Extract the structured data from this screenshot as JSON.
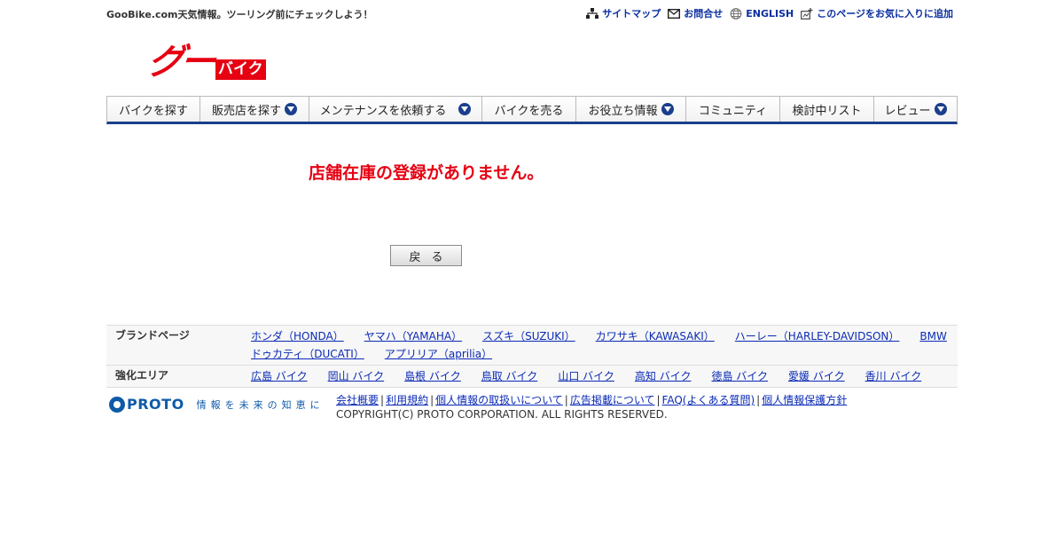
{
  "header": {
    "tagline": "GooBike.com天気情報。ツーリング前にチェックしよう！",
    "links": [
      {
        "label": "サイトマップ",
        "icon": "sitemap-icon"
      },
      {
        "label": "お問合せ",
        "icon": "mail-icon"
      },
      {
        "label": "ENGLISH",
        "icon": "globe-icon"
      },
      {
        "label": "このページをお気に入りに追加",
        "icon": "bookmark-add-icon"
      }
    ]
  },
  "logo": {
    "goo": "グー",
    "bike": "バイク",
    "color": "#e60012"
  },
  "nav": [
    {
      "label": "バイクを探す",
      "dropdown": false
    },
    {
      "label": "販売店を探す",
      "dropdown": true
    },
    {
      "label": "メンテナンスを依頼する",
      "dropdown": true
    },
    {
      "label": "バイクを売る",
      "dropdown": false
    },
    {
      "label": "お役立ち情報",
      "dropdown": true
    },
    {
      "label": "コミュニティ",
      "dropdown": false
    },
    {
      "label": "検討中リスト",
      "dropdown": false
    },
    {
      "label": "レビュー",
      "dropdown": true
    }
  ],
  "main": {
    "message": "店舗在庫の登録がありません。",
    "back_button": "戻る"
  },
  "footer_table": [
    {
      "heading": "ブランドページ",
      "links": [
        "ホンダ（HONDA）",
        "ヤマハ（YAMAHA）",
        "スズキ（SUZUKI）",
        "カワサキ（KAWASAKI）",
        "ハーレー（HARLEY-DAVIDSON）",
        "BMW",
        "ドゥカティ（DUCATI）",
        "アプリリア（aprilia）"
      ]
    },
    {
      "heading": "強化エリア",
      "links": [
        "広島 バイク",
        "岡山 バイク",
        "島根 バイク",
        "鳥取 バイク",
        "山口 バイク",
        "高知 バイク",
        "徳島 バイク",
        "愛媛 バイク",
        "香川 バイク"
      ]
    }
  ],
  "footer": {
    "company_logo": "PROTO",
    "slogan": "情報を未来の知恵に",
    "links": [
      "会社概要",
      "利用規約",
      "個人情報の取扱いについて",
      "広告掲載について",
      "FAQ(よくある質問)",
      "個人情報保護方針"
    ],
    "copyright": "COPYRIGHT(C) PROTO CORPORATION. ALL RIGHTS RESERVED."
  },
  "colors": {
    "accent_red": "#e60012",
    "nav_blue": "#1a3f8c",
    "link_blue": "#0b2bb5"
  }
}
